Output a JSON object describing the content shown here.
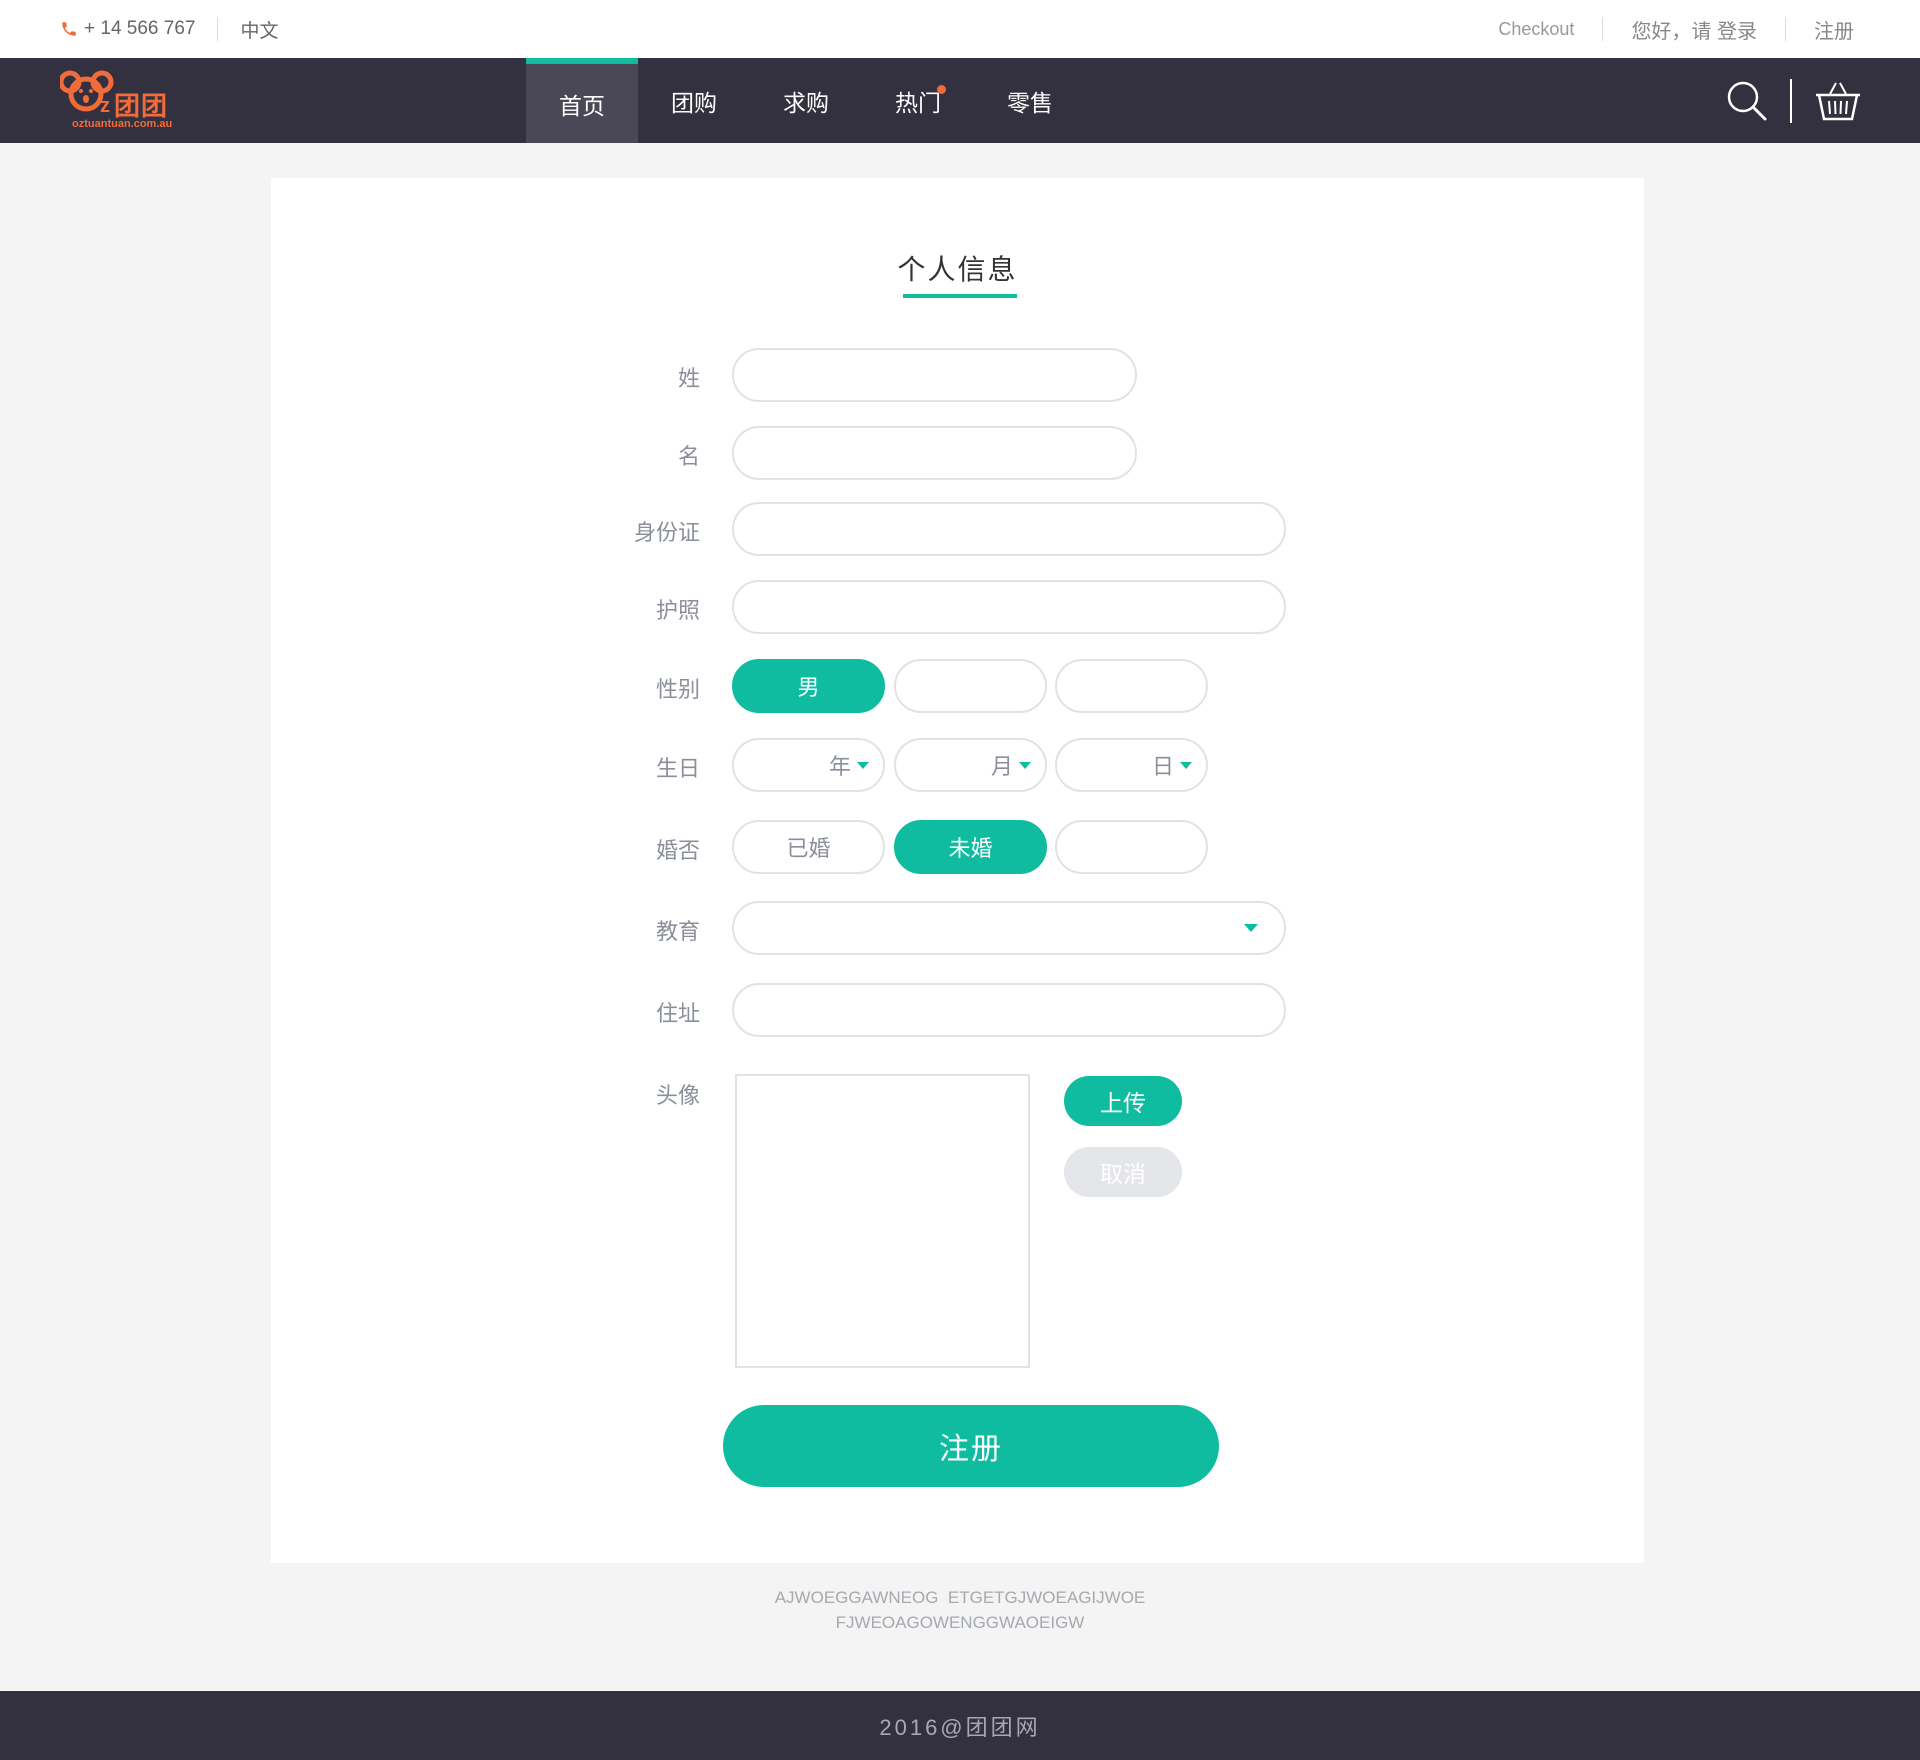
{
  "topbar": {
    "phone": "+ 14 566 767",
    "language": "中文",
    "checkout": "Checkout",
    "login": "您好，请 登录",
    "register": "注册"
  },
  "brand": {
    "logo_text": "团团",
    "logo_url": "oztuantuan.com.au",
    "accent": "#10bca0",
    "brand_color": "#f26b3a",
    "nav_bg": "#33313f"
  },
  "nav": {
    "items": [
      {
        "label": "首页"
      },
      {
        "label": "团购"
      },
      {
        "label": "求购"
      },
      {
        "label": "热门"
      },
      {
        "label": "零售"
      }
    ]
  },
  "form": {
    "title": "个人信息",
    "labels": {
      "surname": "姓",
      "given_name": "名",
      "id_card": "身份证",
      "passport": "护照",
      "gender": "性别",
      "birthday": "生日",
      "marital": "婚否",
      "education": "教育",
      "address": "住址",
      "avatar": "头像"
    },
    "gender_options": [
      "男",
      "",
      ""
    ],
    "birthday": {
      "year": "年",
      "month": "月",
      "day": "日"
    },
    "marital_options": [
      "已婚",
      "未婚",
      ""
    ],
    "upload": "上传",
    "cancel": "取消",
    "submit": "注册"
  },
  "footer": {
    "line1": "AJWOEGGAWNEOG  ETGETGJWOEAGIJWOE",
    "line2": "FJWEOAGOWENGGWAOEIGW",
    "copyright": "2016@团团网"
  }
}
